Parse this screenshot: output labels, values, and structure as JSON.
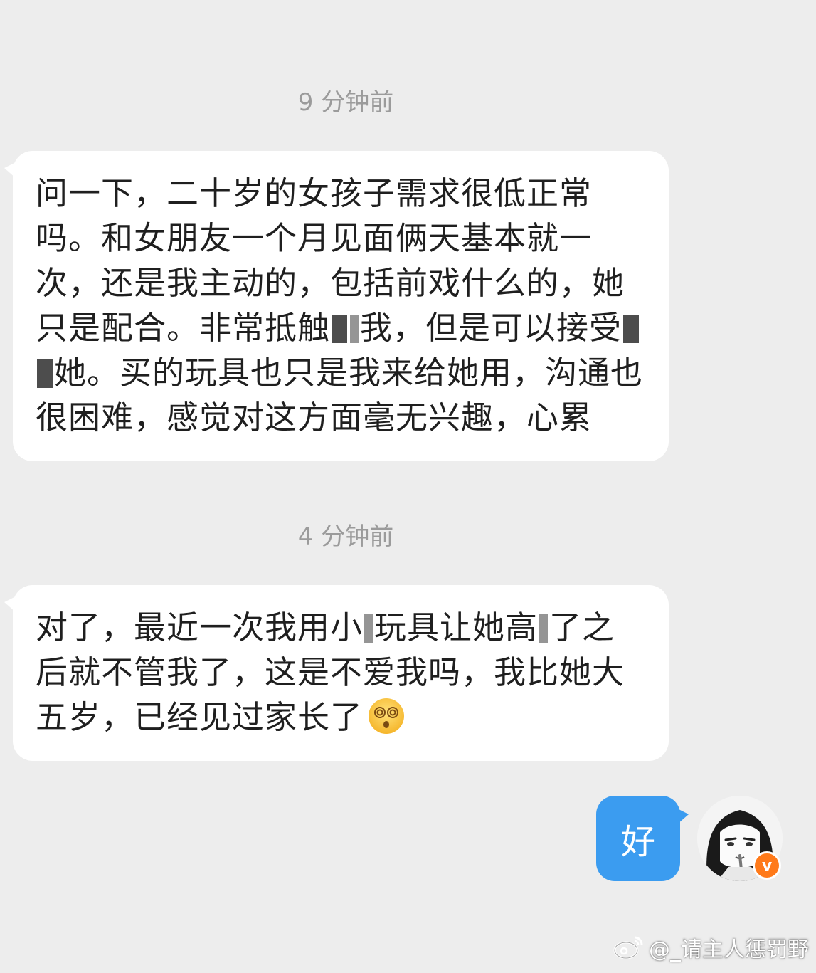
{
  "chat": {
    "messages": [
      {
        "timestamp": "9 分钟前",
        "segments": [
          "问一下，二十岁的女孩子需求很低正常吗。和女朋友一个月见面俩天基本就一次，还是我主动的，包括前戏什么的，她只是配合。非常抵触",
          "我，但是可以接受",
          "她。买的玩具也只是我来给她用，沟通也很困难，感觉对这方面毫无兴趣，心累"
        ]
      },
      {
        "timestamp": "4 分钟前",
        "segments": [
          "对了，最近一次我用小",
          "玩具让她高",
          "了之后就不管我了，这是不爱我吗，我比她大五岁，已经见过家长了"
        ],
        "emoji": "dizzy-face-emoji"
      }
    ],
    "reply": {
      "text": "好"
    }
  },
  "avatar": {
    "icon": "anime-girl-avatar",
    "badge": "v"
  },
  "watermark": {
    "icon": "weibo-logo-icon",
    "text": "@_请主人惩罚野"
  },
  "colors": {
    "background": "#ededed",
    "incoming_bubble": "#ffffff",
    "outgoing_bubble": "#3b9cf0",
    "timestamp": "#9b9b9b",
    "verified_badge": "#ff7a1a"
  }
}
